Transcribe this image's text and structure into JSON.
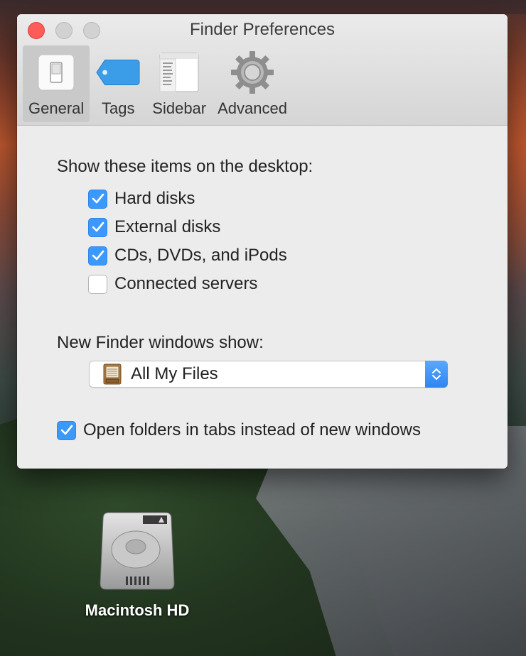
{
  "window": {
    "title": "Finder Preferences"
  },
  "toolbar": {
    "tabs": [
      {
        "label": "General",
        "icon": "switch-icon",
        "selected": true
      },
      {
        "label": "Tags",
        "icon": "tag-icon",
        "selected": false
      },
      {
        "label": "Sidebar",
        "icon": "sidebar-icon",
        "selected": false
      },
      {
        "label": "Advanced",
        "icon": "gear-icon",
        "selected": false
      }
    ]
  },
  "general": {
    "desktop_heading": "Show these items on the desktop:",
    "desktop_items": [
      {
        "label": "Hard disks",
        "checked": true
      },
      {
        "label": "External disks",
        "checked": true
      },
      {
        "label": "CDs, DVDs, and iPods",
        "checked": true
      },
      {
        "label": "Connected servers",
        "checked": false
      }
    ],
    "new_window_heading": "New Finder windows show:",
    "new_window_value": "All My Files",
    "new_window_icon": "file-cabinet-icon",
    "tabs_option": {
      "label": "Open folders in tabs instead of new windows",
      "checked": true
    }
  },
  "desktop": {
    "items": [
      {
        "label": "Macintosh HD",
        "icon": "hard-drive-icon"
      }
    ]
  },
  "colors": {
    "accent": "#3b99fc",
    "close": "#fc5d58"
  }
}
